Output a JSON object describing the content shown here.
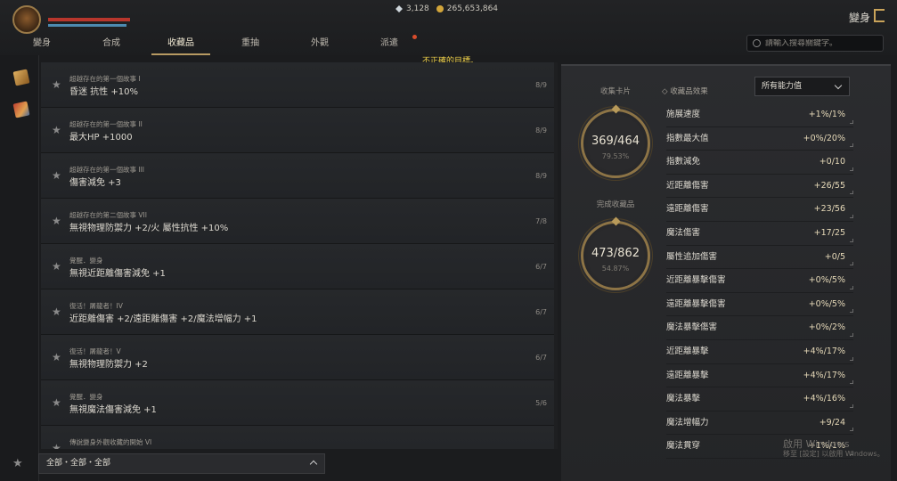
{
  "header": {
    "diamonds": "3,128",
    "gold": "265,653,864",
    "page_name": "變身"
  },
  "tabs": [
    {
      "label": "變身"
    },
    {
      "label": "合成"
    },
    {
      "label": "收藏品"
    },
    {
      "label": "重抽"
    },
    {
      "label": "外觀"
    },
    {
      "label": "派遣"
    }
  ],
  "warning": "不正確的目標。",
  "search": {
    "placeholder": "請輸入搜尋關鍵字。"
  },
  "collections": [
    {
      "category": "超越存在的第一個故事 I",
      "effect": "昏迷 抗性 +10%",
      "count": "8/9"
    },
    {
      "category": "超越存在的第一個故事 II",
      "effect": "最大HP +1000",
      "count": "8/9"
    },
    {
      "category": "超越存在的第一個故事 III",
      "effect": "傷害減免 +3",
      "count": "8/9"
    },
    {
      "category": "超越存在的第二個故事 VII",
      "effect": "無視物理防禦力 +2/火 屬性抗性 +10%",
      "count": "7/8"
    },
    {
      "category": "覺醒．變身",
      "effect": "無視近距離傷害減免 +1",
      "count": "6/7"
    },
    {
      "category": "復活！屠龍者！IV",
      "effect": "近距離傷害 +2/遠距離傷害 +2/魔法增幅力 +1",
      "count": "6/7"
    },
    {
      "category": "復活！屠龍者！V",
      "effect": "無視物理防禦力 +2",
      "count": "6/7"
    },
    {
      "category": "覺醒．變身",
      "effect": "無視魔法傷害減免 +1",
      "count": "5/6"
    },
    {
      "category": "傳說變身外觀收藏的開始 VI",
      "effect": "",
      "count": ""
    }
  ],
  "filter": {
    "label": "全部・全部・全部"
  },
  "summary": {
    "cards_label": "收集卡片",
    "cards_value": "369/464",
    "cards_pct": "79.53%",
    "done_label": "完成收藏品",
    "done_value": "473/862",
    "done_pct": "54.87%"
  },
  "stats_header": "收藏品效果",
  "stats_select": "所有能力值",
  "stats": [
    {
      "name": "施展速度",
      "value": "+1%/1%"
    },
    {
      "name": "指數最大值",
      "value": "+0%/20%"
    },
    {
      "name": "指數減免",
      "value": "+0/10"
    },
    {
      "name": "近距離傷害",
      "value": "+26/55"
    },
    {
      "name": "遠距離傷害",
      "value": "+23/56"
    },
    {
      "name": "魔法傷害",
      "value": "+17/25"
    },
    {
      "name": "屬性追加傷害",
      "value": "+0/5"
    },
    {
      "name": "近距離暴擊傷害",
      "value": "+0%/5%"
    },
    {
      "name": "遠距離暴擊傷害",
      "value": "+0%/5%"
    },
    {
      "name": "魔法暴擊傷害",
      "value": "+0%/2%"
    },
    {
      "name": "近距離暴擊",
      "value": "+4%/17%"
    },
    {
      "name": "遠距離暴擊",
      "value": "+4%/17%"
    },
    {
      "name": "魔法暴擊",
      "value": "+4%/16%"
    },
    {
      "name": "魔法增幅力",
      "value": "+9/24"
    },
    {
      "name": "魔法貫穿",
      "value": "+1%/1%"
    }
  ],
  "watermark": {
    "line1": "啟用 Windows",
    "line2": "移至 [設定] 以啟用 Windows。"
  }
}
